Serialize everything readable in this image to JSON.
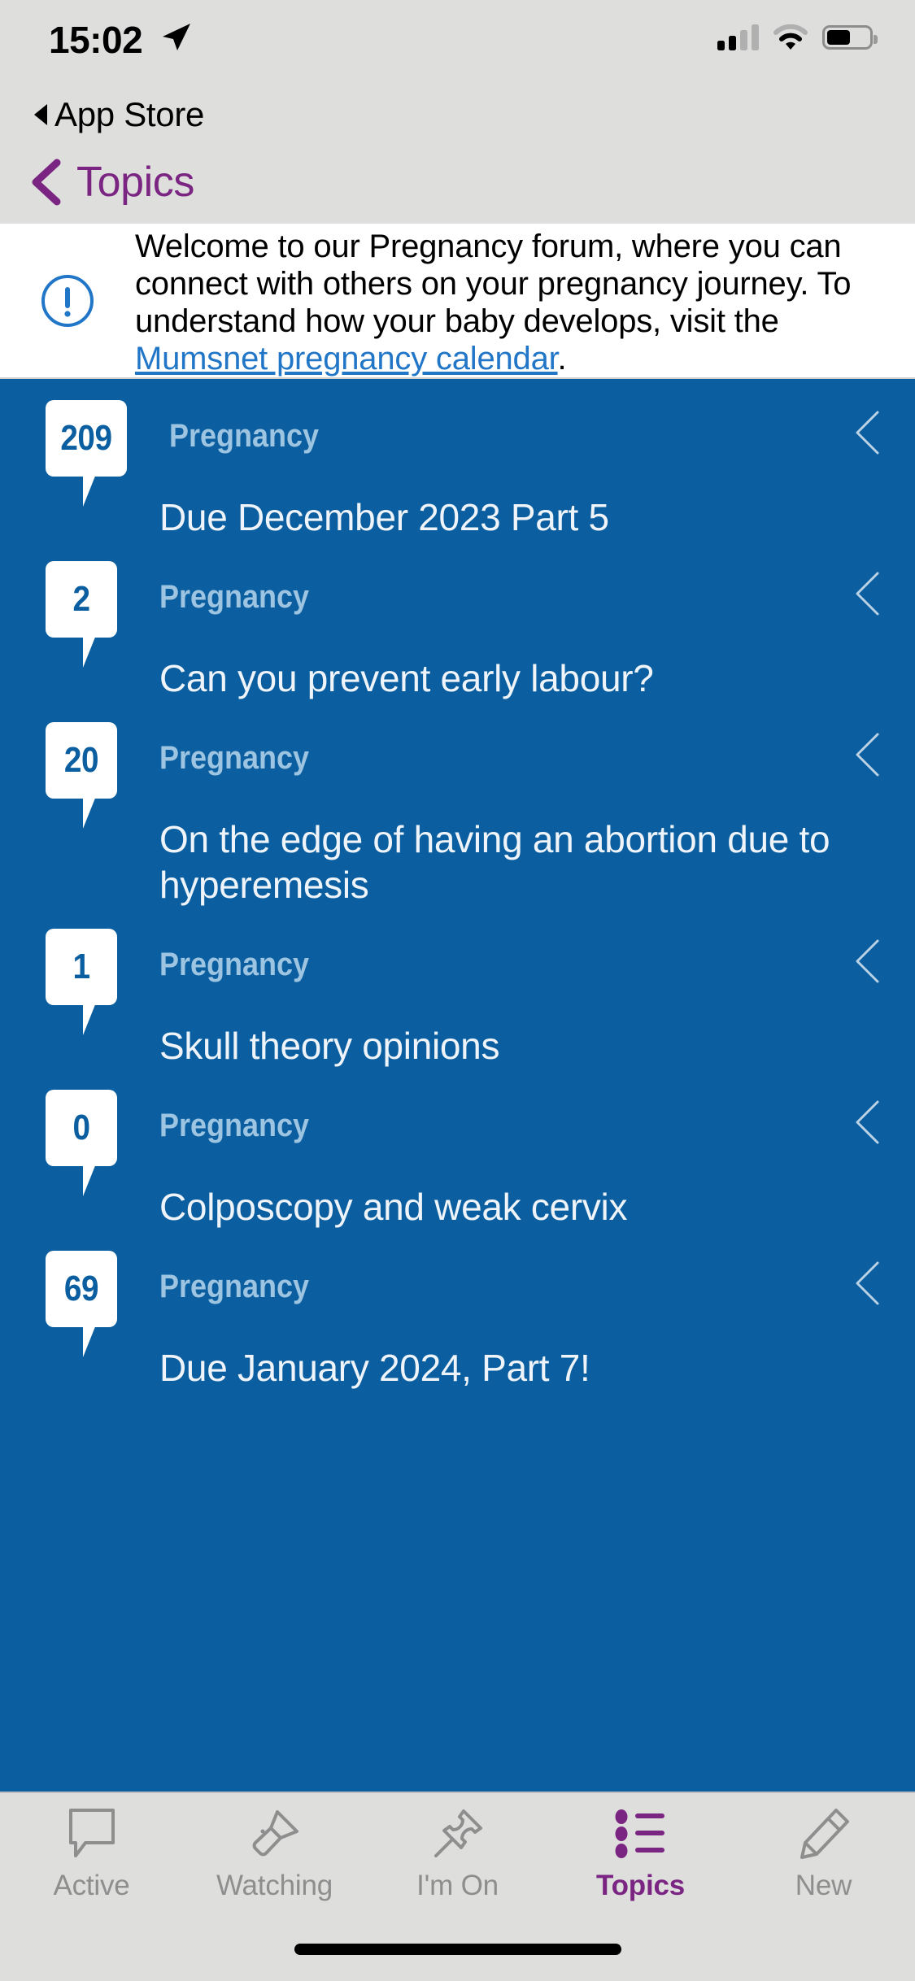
{
  "status_bar": {
    "time": "15:02",
    "location_icon": "location-arrow-icon",
    "signal_icon": "cellular-signal-icon",
    "wifi_icon": "wifi-icon",
    "battery_icon": "battery-icon",
    "battery_level_percent": 55,
    "signal_bars_filled": 2,
    "signal_bars_total": 4
  },
  "return_app": {
    "label": "App Store",
    "back_icon": "back-triangle-icon"
  },
  "nav": {
    "title": "Topics",
    "back_icon": "chevron-left-icon",
    "accent_color": "#7B2583"
  },
  "banner": {
    "icon": "info-exclamation-circle-icon",
    "text_before_link": "Welcome to our Pregnancy forum, where you can connect with others on your pregnancy journey. To understand how your baby develops, visit the ",
    "link_text": "Mumsnet pregnancy calendar",
    "text_after_link": ".",
    "link_color": "#2176c7",
    "background": "#ffffff"
  },
  "list": {
    "background": "#0B5FA0",
    "badge_background": "#ffffff",
    "badge_text_color": "#0B5FA0",
    "topic_label_color": "#9dc4e0",
    "threads": [
      {
        "count": "209",
        "topic": "Pregnancy",
        "title": "Due December 2023 Part 5",
        "chevron": "chevron-left-icon"
      },
      {
        "count": "2",
        "topic": "Pregnancy",
        "title": "Can you prevent early labour?",
        "chevron": "chevron-left-icon"
      },
      {
        "count": "20",
        "topic": "Pregnancy",
        "title": "On the edge of having an abortion due to hyperemesis",
        "chevron": "chevron-left-icon"
      },
      {
        "count": "1",
        "topic": "Pregnancy",
        "title": "Skull theory opinions",
        "chevron": "chevron-left-icon"
      },
      {
        "count": "0",
        "topic": "Pregnancy",
        "title": "Colposcopy and weak cervix",
        "chevron": "chevron-left-icon"
      },
      {
        "count": "69",
        "topic": "Pregnancy",
        "title": "Due January 2024, Part 7!",
        "chevron": "chevron-left-icon"
      }
    ]
  },
  "tabbar": {
    "active_color": "#7B2583",
    "inactive_color": "#8e8e8e",
    "items": [
      {
        "label": "Active",
        "icon": "speech-bubble-icon",
        "active": false
      },
      {
        "label": "Watching",
        "icon": "flashlight-icon",
        "active": false
      },
      {
        "label": "I'm On",
        "icon": "pushpin-icon",
        "active": false
      },
      {
        "label": "Topics",
        "icon": "bulleted-list-icon",
        "active": true
      },
      {
        "label": "New",
        "icon": "pencil-icon",
        "active": false
      }
    ]
  },
  "home_indicator": "home-bar"
}
